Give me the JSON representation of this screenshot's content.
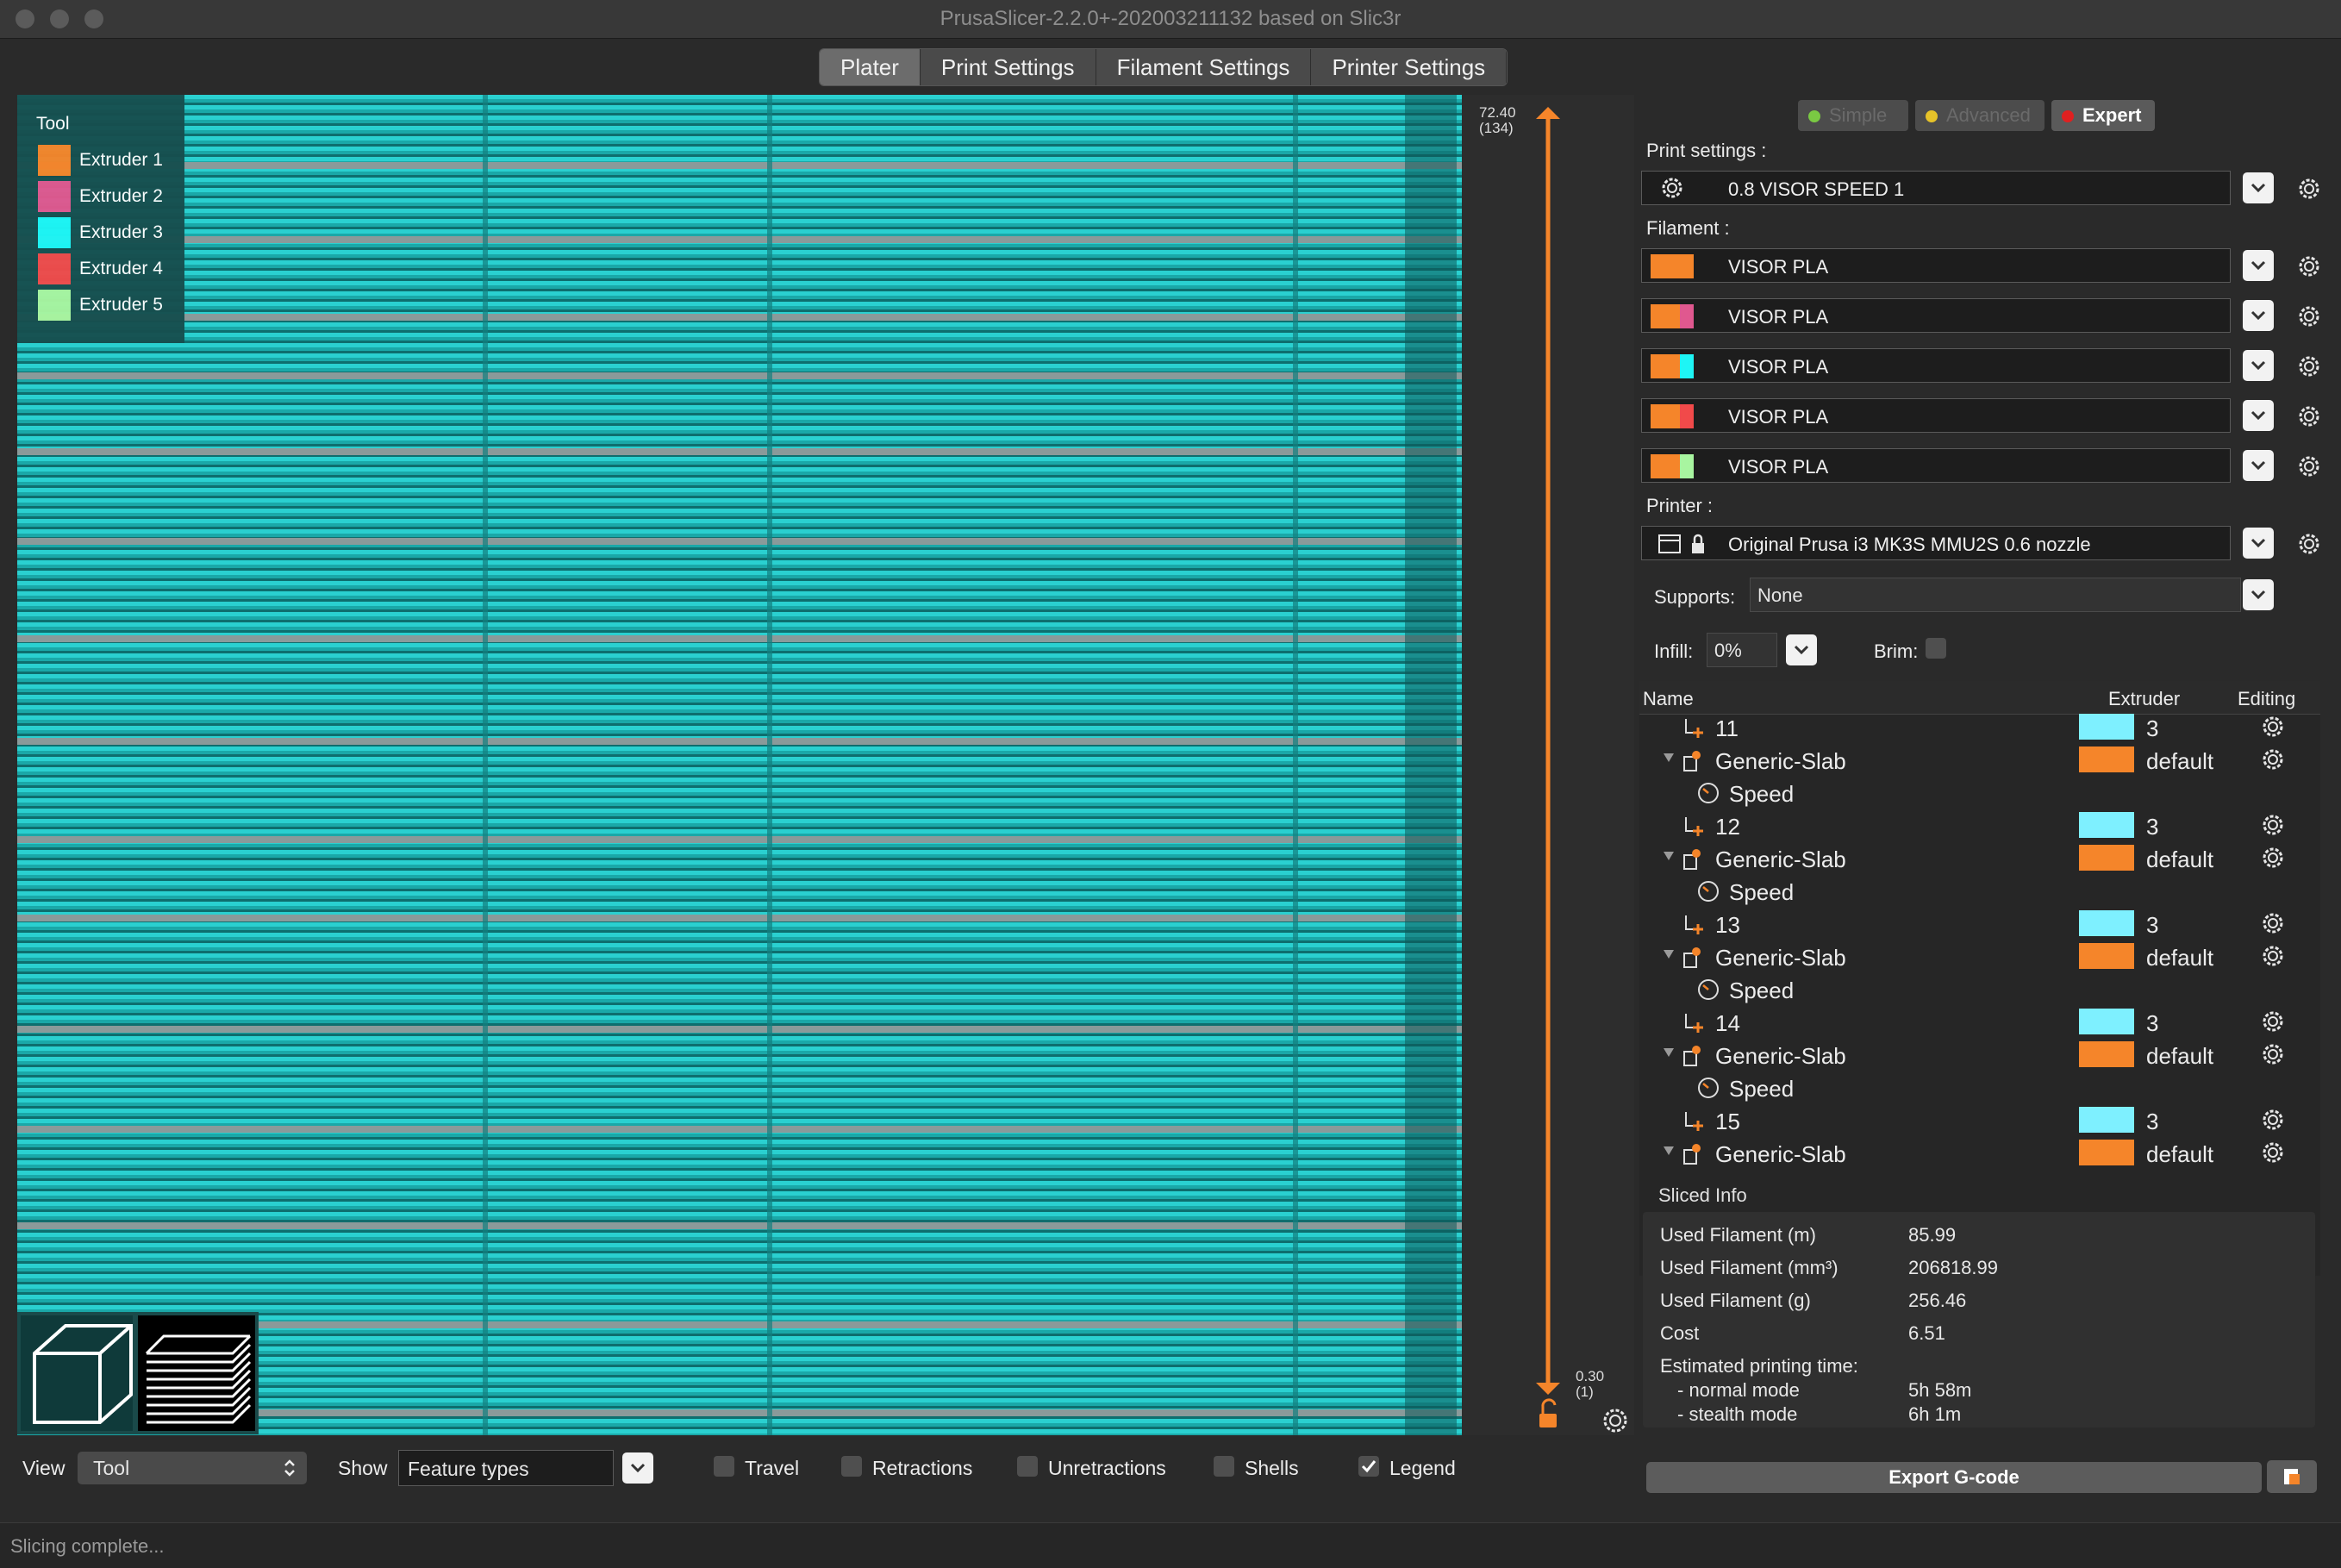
{
  "window": {
    "title": "PrusaSlicer-2.2.0+-202003211132 based on Slic3r"
  },
  "tabs": [
    "Plater",
    "Print Settings",
    "Filament Settings",
    "Printer Settings"
  ],
  "legend": {
    "title": "Tool",
    "items": [
      {
        "label": "Extruder 1",
        "color": "#f5852a"
      },
      {
        "label": "Extruder 2",
        "color": "#e0588f"
      },
      {
        "label": "Extruder 3",
        "color": "#1ef5f5"
      },
      {
        "label": "Extruder 4",
        "color": "#f14a4a"
      },
      {
        "label": "Extruder 5",
        "color": "#a8f5a0"
      }
    ]
  },
  "layer_slider": {
    "top_value": "72.40",
    "top_layer": "(134)",
    "bottom_value": "0.30",
    "bottom_layer": "(1)"
  },
  "modes": [
    {
      "label": "Simple",
      "color": "#7ac943",
      "active": false
    },
    {
      "label": "Advanced",
      "color": "#e6c229",
      "active": false
    },
    {
      "label": "Expert",
      "color": "#e02020",
      "active": true
    }
  ],
  "print_settings": {
    "label": "Print settings :",
    "value": "0.8 VISOR SPEED 1"
  },
  "filament": {
    "label": "Filament :",
    "items": [
      {
        "name": "VISOR PLA",
        "color": "#f5852a"
      },
      {
        "name": "VISOR PLA",
        "color": "#e0588f"
      },
      {
        "name": "VISOR PLA",
        "color": "#1ef5f5"
      },
      {
        "name": "VISOR PLA",
        "color": "#f14a4a"
      },
      {
        "name": "VISOR PLA",
        "color": "#a8f5a0"
      }
    ]
  },
  "printer": {
    "label": "Printer :",
    "value": "Original Prusa i3 MK3S MMU2S 0.6 nozzle"
  },
  "supports": {
    "label": "Supports:",
    "value": "None"
  },
  "infill": {
    "label": "Infill:",
    "value": "0%"
  },
  "brim": {
    "label": "Brim:"
  },
  "object_list": {
    "columns": [
      "Name",
      "Extruder",
      "Editing"
    ],
    "rows": [
      {
        "name": "11",
        "kind": "part",
        "extruder": "3",
        "ext_color": "#7ef0ff"
      },
      {
        "name": "Generic-Slab",
        "kind": "modifier",
        "extruder": "default",
        "ext_color": "#f5852a"
      },
      {
        "name": "Speed",
        "kind": "setting",
        "extruder": "",
        "ext_color": ""
      },
      {
        "name": "12",
        "kind": "part",
        "extruder": "3",
        "ext_color": "#7ef0ff"
      },
      {
        "name": "Generic-Slab",
        "kind": "modifier",
        "extruder": "default",
        "ext_color": "#f5852a"
      },
      {
        "name": "Speed",
        "kind": "setting",
        "extruder": "",
        "ext_color": ""
      },
      {
        "name": "13",
        "kind": "part",
        "extruder": "3",
        "ext_color": "#7ef0ff"
      },
      {
        "name": "Generic-Slab",
        "kind": "modifier",
        "extruder": "default",
        "ext_color": "#f5852a"
      },
      {
        "name": "Speed",
        "kind": "setting",
        "extruder": "",
        "ext_color": ""
      },
      {
        "name": "14",
        "kind": "part",
        "extruder": "3",
        "ext_color": "#7ef0ff"
      },
      {
        "name": "Generic-Slab",
        "kind": "modifier",
        "extruder": "default",
        "ext_color": "#f5852a"
      },
      {
        "name": "Speed",
        "kind": "setting",
        "extruder": "",
        "ext_color": ""
      },
      {
        "name": "15",
        "kind": "part",
        "extruder": "3",
        "ext_color": "#7ef0ff"
      },
      {
        "name": "Generic-Slab",
        "kind": "modifier",
        "extruder": "default",
        "ext_color": "#f5852a"
      }
    ]
  },
  "sliced_info": {
    "title": "Sliced Info",
    "rows": [
      {
        "label": "Used Filament (m)",
        "value": "85.99"
      },
      {
        "label": "Used Filament (mm³)",
        "value": "206818.99"
      },
      {
        "label": "Used Filament (g)",
        "value": "256.46"
      },
      {
        "label": "Cost",
        "value": "6.51"
      },
      {
        "label": "Estimated printing time:",
        "value": ""
      },
      {
        "label": "- normal mode",
        "value": "5h 58m"
      },
      {
        "label": "- stealth mode",
        "value": "6h 1m"
      }
    ]
  },
  "export_button": "Export G-code",
  "bottom_bar": {
    "view_label": "View",
    "view_value": "Tool",
    "show_label": "Show",
    "show_value": "Feature types",
    "checks": [
      {
        "label": "Travel",
        "checked": false
      },
      {
        "label": "Retractions",
        "checked": false
      },
      {
        "label": "Unretractions",
        "checked": false
      },
      {
        "label": "Shells",
        "checked": false
      },
      {
        "label": "Legend",
        "checked": true
      }
    ]
  },
  "status": "Slicing complete..."
}
